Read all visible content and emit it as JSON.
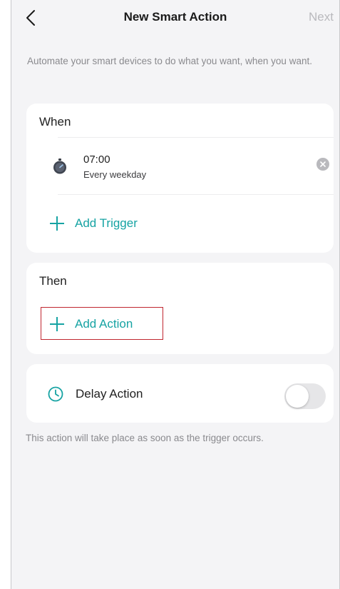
{
  "header": {
    "back_icon": "chevron-left-icon",
    "title": "New Smart Action",
    "next_label": "Next"
  },
  "description": "Automate your smart devices to do what you want, when you want.",
  "when_section": {
    "title": "When",
    "trigger": {
      "icon": "stopwatch-icon",
      "time": "07:00",
      "repeat": "Every weekday"
    },
    "add_trigger_label": "Add Trigger"
  },
  "then_section": {
    "title": "Then",
    "add_action_label": "Add Action"
  },
  "delay_section": {
    "icon": "clock-icon",
    "label": "Delay Action",
    "enabled": false
  },
  "footnote": "This action will take place as soon as the trigger occurs.",
  "colors": {
    "accent": "#16a3a3",
    "highlight_box": "#c0262f",
    "background": "#f4f4f6"
  }
}
